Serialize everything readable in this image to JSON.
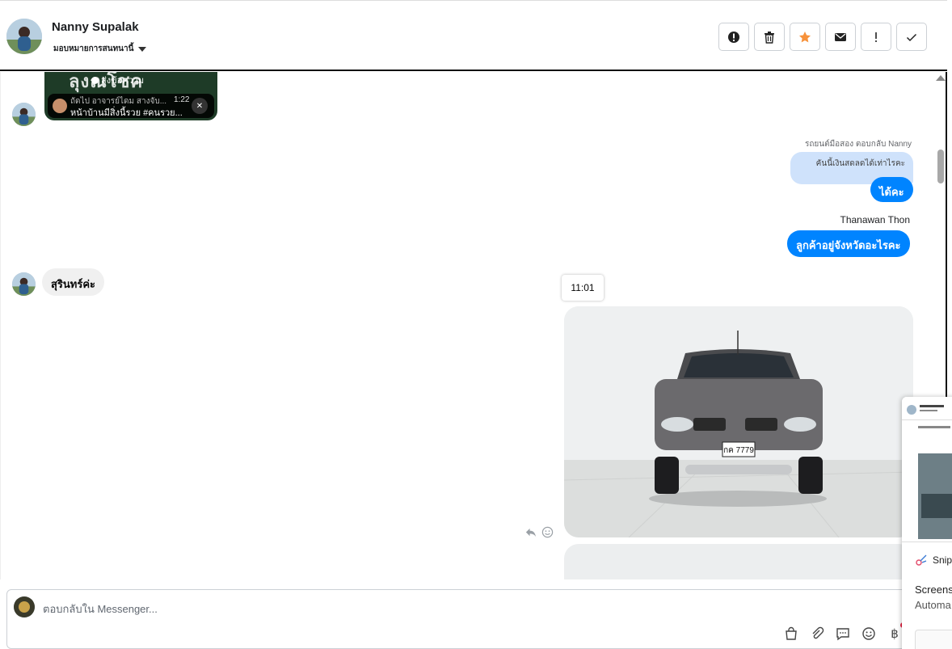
{
  "header": {
    "contact_name": "Nanny Supalak",
    "assign_label": "มอบหมายการสนทนานี้",
    "actions": [
      {
        "name": "report-spam-button",
        "icon": "alert-circle-icon"
      },
      {
        "name": "delete-button",
        "icon": "trash-icon"
      },
      {
        "name": "star-button",
        "icon": "star-icon",
        "color": "#f7923b"
      },
      {
        "name": "mark-unread-button",
        "icon": "envelope-icon"
      },
      {
        "name": "priority-button",
        "icon": "exclamation-icon"
      },
      {
        "name": "mark-done-button",
        "icon": "check-icon"
      }
    ]
  },
  "shared_post": {
    "overlay_text": "ส่งข้อความ",
    "subtitle": "ถัดไป อาจารย์ไดม สางจับ...",
    "duration": "1:22",
    "title": "หน้าบ้านมีสิ่งนี้รวย #คนรวย..."
  },
  "messages": {
    "reply_meta": "รถยนต์มือสอง ตอบกลับ Nanny",
    "quoted_text": "คันนี้เงินสดลดได้เท่าไรคะ",
    "outgoing_1": "ได้คะ",
    "sender_name": "Thanawan Thon",
    "outgoing_2": "ลูกค้าอยู่จังหวัดอะไรคะ",
    "incoming_1": "สุรินทร์ค่ะ",
    "time_chip": "11:01",
    "plate_text": "กค 7779"
  },
  "composer": {
    "placeholder": "ตอบกลับใน Messenger..."
  },
  "snip": {
    "app_name": "Snip",
    "line1": "Screens",
    "line2": "Automa"
  },
  "colors": {
    "accent": "#0084ff",
    "quoted_bg": "#cfe2fb",
    "star": "#f7923b"
  }
}
